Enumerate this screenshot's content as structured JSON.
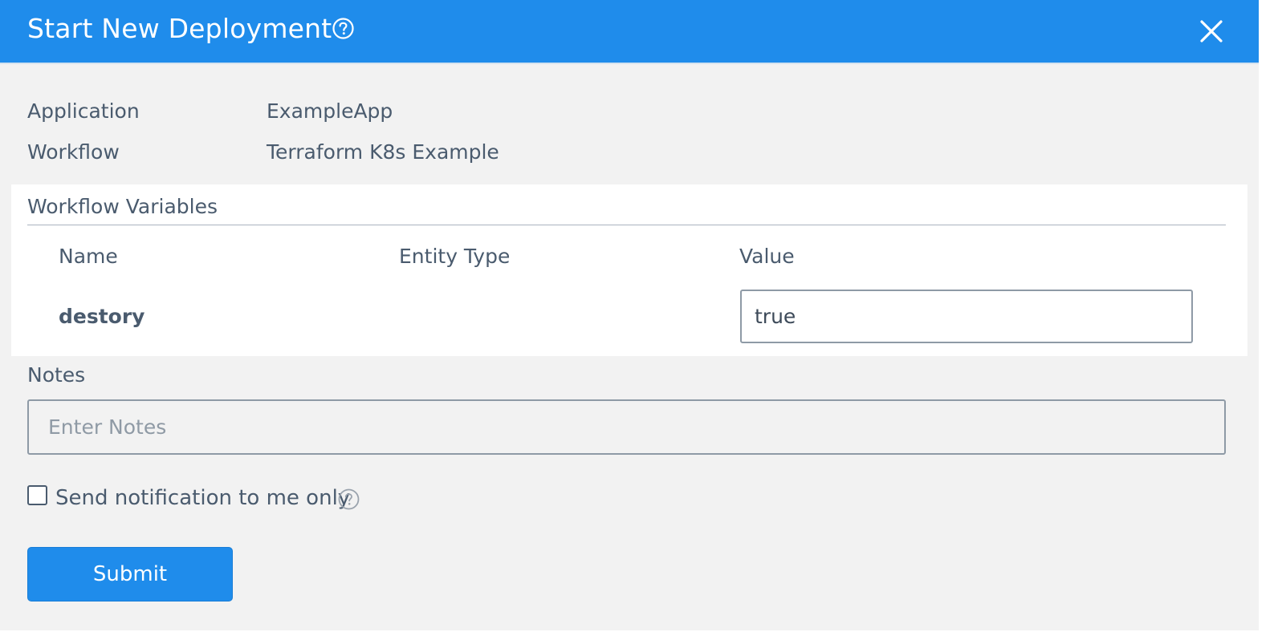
{
  "dialog": {
    "title": "Start New Deployment",
    "help_icon": "question-circle-icon",
    "close_icon": "close-x-icon"
  },
  "info": {
    "application_label": "Application",
    "application_value": "ExampleApp",
    "workflow_label": "Workflow",
    "workflow_value": "Terraform K8s Example"
  },
  "workflow_variables": {
    "title": "Workflow Variables",
    "columns": [
      "Name",
      "Entity Type",
      "Value"
    ],
    "rows": [
      {
        "name": "destory",
        "entity_type": "",
        "value": "true"
      }
    ]
  },
  "notes": {
    "label": "Notes",
    "placeholder": "Enter Notes",
    "value": ""
  },
  "notification": {
    "label": "Send notification to me only",
    "checked": false,
    "help_icon": "question-circle-icon"
  },
  "actions": {
    "submit_label": "Submit"
  },
  "colors": {
    "header_bg": "#1f8ceb",
    "dialog_bg": "#f2f2f2",
    "text": "#4a5b6e",
    "primary_button": "#1f8ceb"
  }
}
